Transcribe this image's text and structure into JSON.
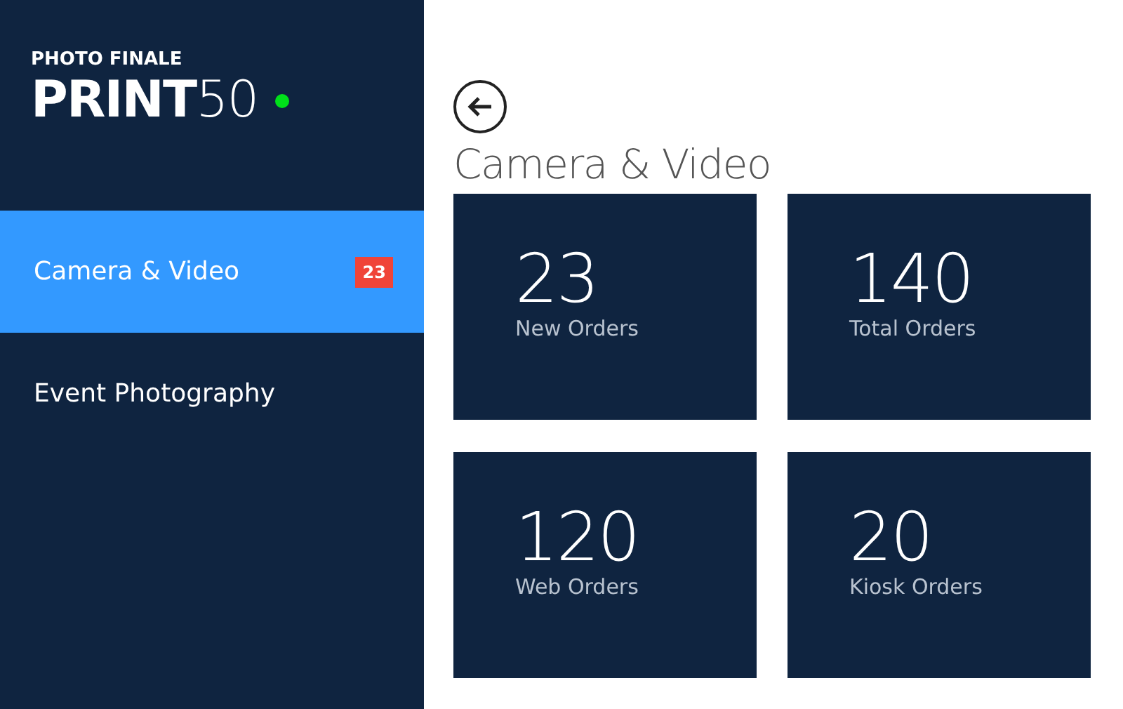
{
  "logo": {
    "brand": "PHOTO FINALE",
    "product_bold": "PRINT",
    "product_light": "50"
  },
  "sidebar": {
    "items": [
      {
        "label": "Camera & Video",
        "selected": true,
        "badge": "23"
      },
      {
        "label": "Event Photography",
        "selected": false
      }
    ]
  },
  "page": {
    "title": "Camera & Video"
  },
  "tiles": [
    {
      "value": "23",
      "label": "New Orders"
    },
    {
      "value": "140",
      "label": "Total Orders"
    },
    {
      "value": "120",
      "label": "Web Orders"
    },
    {
      "value": "20",
      "label": "Kiosk Orders"
    }
  ]
}
